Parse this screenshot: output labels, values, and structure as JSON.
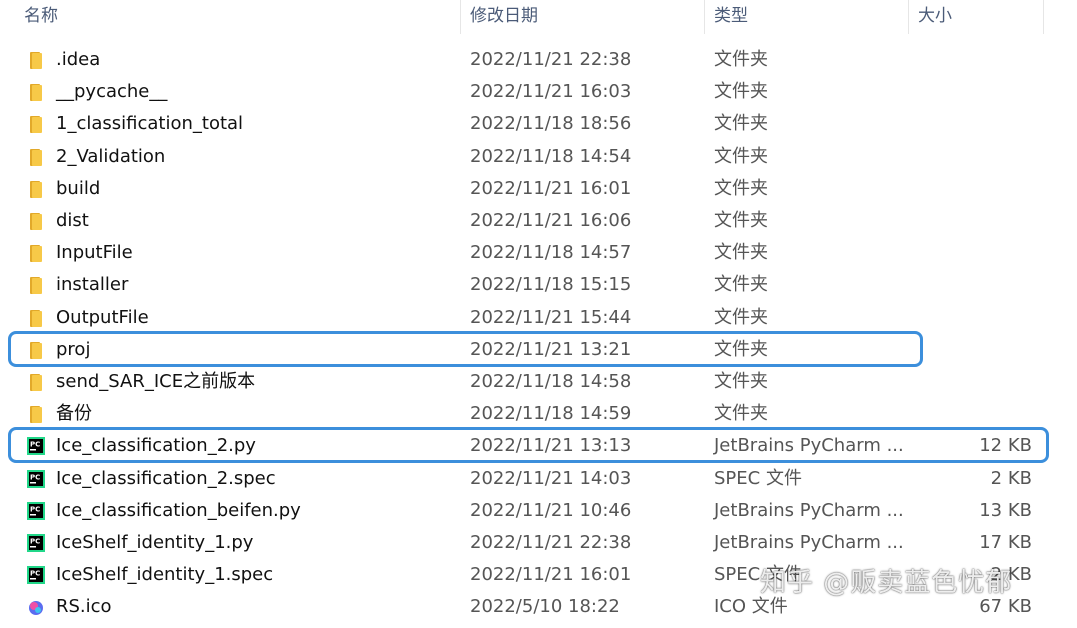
{
  "header": {
    "name": "名称",
    "date": "修改日期",
    "type": "类型",
    "size": "大小"
  },
  "files": [
    {
      "name": ".idea",
      "date": "2022/11/21 22:38",
      "type": "文件夹",
      "size": "",
      "icon": "folder-icon"
    },
    {
      "name": "__pycache__",
      "date": "2022/11/21 16:03",
      "type": "文件夹",
      "size": "",
      "icon": "folder-icon"
    },
    {
      "name": "1_classification_total",
      "date": "2022/11/18 18:56",
      "type": "文件夹",
      "size": "",
      "icon": "folder-icon"
    },
    {
      "name": "2_Validation",
      "date": "2022/11/18 14:54",
      "type": "文件夹",
      "size": "",
      "icon": "folder-icon"
    },
    {
      "name": "build",
      "date": "2022/11/21 16:01",
      "type": "文件夹",
      "size": "",
      "icon": "folder-icon"
    },
    {
      "name": "dist",
      "date": "2022/11/21 16:06",
      "type": "文件夹",
      "size": "",
      "icon": "folder-icon"
    },
    {
      "name": "InputFile",
      "date": "2022/11/18 14:57",
      "type": "文件夹",
      "size": "",
      "icon": "folder-icon"
    },
    {
      "name": "installer",
      "date": "2022/11/18 15:15",
      "type": "文件夹",
      "size": "",
      "icon": "folder-icon"
    },
    {
      "name": "OutputFile",
      "date": "2022/11/21 15:44",
      "type": "文件夹",
      "size": "",
      "icon": "folder-icon"
    },
    {
      "name": "proj",
      "date": "2022/11/21 13:21",
      "type": "文件夹",
      "size": "",
      "icon": "folder-icon",
      "highlighted": true
    },
    {
      "name": "send_SAR_ICE之前版本",
      "date": "2022/11/18 14:58",
      "type": "文件夹",
      "size": "",
      "icon": "folder-icon"
    },
    {
      "name": "备份",
      "date": "2022/11/18 14:59",
      "type": "文件夹",
      "size": "",
      "icon": "folder-icon"
    },
    {
      "name": "Ice_classification_2.py",
      "date": "2022/11/21 13:13",
      "type": "JetBrains PyCharm ...",
      "size": "12 KB",
      "icon": "pycharm-icon",
      "highlighted": true
    },
    {
      "name": "Ice_classification_2.spec",
      "date": "2022/11/21 14:03",
      "type": "SPEC 文件",
      "size": "2 KB",
      "icon": "pycharm-icon"
    },
    {
      "name": "Ice_classification_beifen.py",
      "date": "2022/11/21 10:46",
      "type": "JetBrains PyCharm ...",
      "size": "13 KB",
      "icon": "pycharm-icon"
    },
    {
      "name": "IceShelf_identity_1.py",
      "date": "2022/11/21 22:38",
      "type": "JetBrains PyCharm ...",
      "size": "17 KB",
      "icon": "pycharm-icon"
    },
    {
      "name": "IceShelf_identity_1.spec",
      "date": "2022/11/21 16:01",
      "type": "SPEC 文件",
      "size": "2 KB",
      "icon": "pycharm-icon"
    },
    {
      "name": "RS.ico",
      "date": "2022/5/10 18:22",
      "type": "ICO 文件",
      "size": "67 KB",
      "icon": "ico-file-icon"
    }
  ],
  "watermark": "知乎 @贩卖蓝色忧郁",
  "colors": {
    "highlight": "#3c8fdc",
    "folder": "#f7c948"
  }
}
